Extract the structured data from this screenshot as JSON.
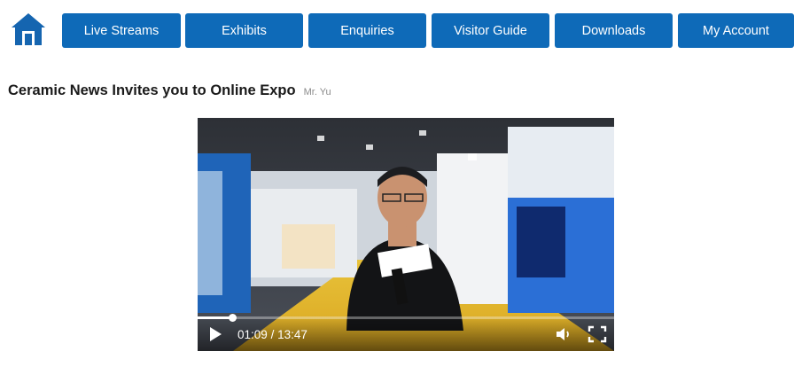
{
  "header": {
    "home_icon": "home-icon",
    "nav": [
      {
        "label": "Live Streams"
      },
      {
        "label": "Exhibits"
      },
      {
        "label": "Enquiries"
      },
      {
        "label": "Visitor Guide"
      },
      {
        "label": "Downloads"
      },
      {
        "label": "My Account"
      }
    ]
  },
  "page": {
    "title": "Ceramic News Invites you to Online Expo",
    "author": "Mr. Yu"
  },
  "video": {
    "current_time": "01:09",
    "duration": "13:47",
    "progress": 0.0834,
    "icons": {
      "play": "play-icon",
      "volume": "volume-icon",
      "fullscreen": "fullscreen-icon"
    }
  },
  "colors": {
    "nav_bg": "#0e6ab8",
    "home_icon": "#1565b0"
  }
}
